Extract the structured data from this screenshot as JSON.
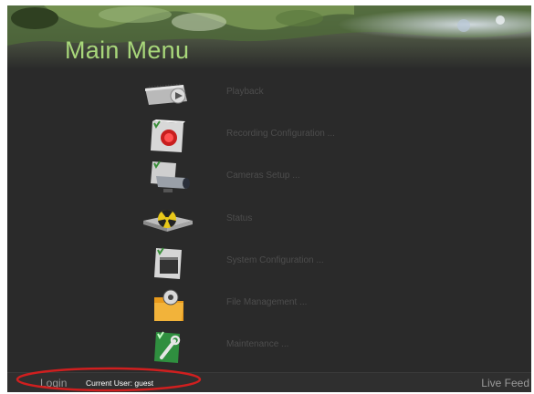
{
  "title": "Main Menu",
  "menu_items": [
    {
      "label": "Playback",
      "icon": "playback-icon"
    },
    {
      "label": "Recording Configuration ...",
      "icon": "record-icon"
    },
    {
      "label": "Cameras Setup ...",
      "icon": "camera-icon"
    },
    {
      "label": "Status",
      "icon": "status-icon"
    },
    {
      "label": "System Configuration ...",
      "icon": "system-config-icon"
    },
    {
      "label": "File Management ...",
      "icon": "folder-icon"
    },
    {
      "label": "Maintenance ...",
      "icon": "maintenance-icon"
    }
  ],
  "bottom_bar": {
    "login": "Login",
    "current_user": "Current User: guest",
    "live_feed": "Live Feed"
  },
  "colors": {
    "background": "#2a2a2a",
    "title": "#a8d77a",
    "menu_label": "#4d4d4d",
    "highlight": "#d01f1f"
  }
}
